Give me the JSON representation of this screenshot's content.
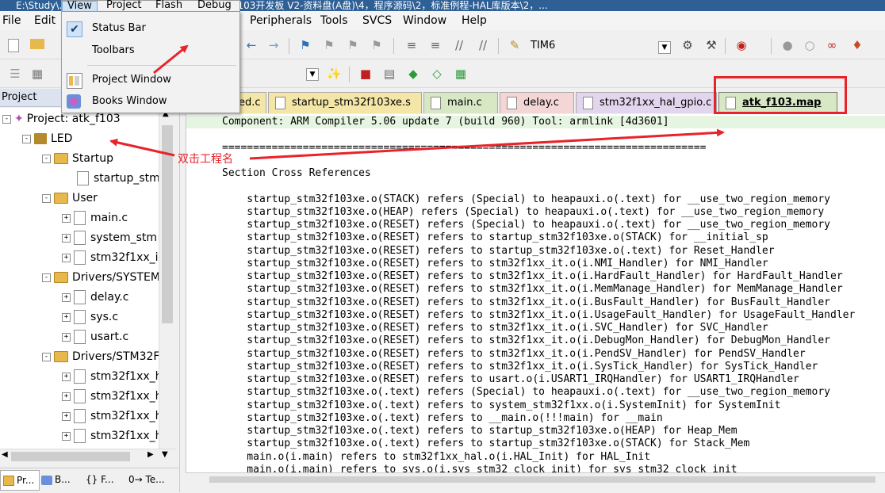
{
  "titlebar": {
    "text": "E:\\Study\\...\\Document\\【正点原子】精英STM32F103开发板 V2-资料盘(A盘)\\4，程序源码\\2，标准例程-HAL库版本\\2，..."
  },
  "menubar": {
    "items": [
      "File",
      "Edit",
      "View",
      "Project",
      "Flash",
      "Debug",
      "Peripherals",
      "Tools",
      "SVCS",
      "Window",
      "Help"
    ]
  },
  "toolbar": {
    "target_label": "TIM6"
  },
  "view_menu": {
    "items": [
      {
        "label": "Status Bar",
        "checked": true,
        "icon": "checkmark-icon"
      },
      {
        "label": "Toolbars",
        "checked": false,
        "icon": ""
      },
      {
        "label": "Project Window",
        "checked": false,
        "icon": "project-window-icon"
      },
      {
        "label": "Books Window",
        "checked": false,
        "icon": "books-window-icon"
      }
    ]
  },
  "project_panel": {
    "header": "Project",
    "tree": [
      {
        "label": "Project: atk_f103",
        "kind": "project",
        "level": 0,
        "expander": "-"
      },
      {
        "label": "LED",
        "kind": "target",
        "level": 1,
        "expander": "-"
      },
      {
        "label": "Startup",
        "kind": "folder",
        "level": 2,
        "expander": "-"
      },
      {
        "label": "startup_stm",
        "kind": "file",
        "level": 3,
        "expander": ""
      },
      {
        "label": "User",
        "kind": "folder",
        "level": 2,
        "expander": "-"
      },
      {
        "label": "main.c",
        "kind": "file",
        "level": 3,
        "expander": "+"
      },
      {
        "label": "system_stm",
        "kind": "file",
        "level": 3,
        "expander": "+"
      },
      {
        "label": "stm32f1xx_i",
        "kind": "file",
        "level": 3,
        "expander": "+"
      },
      {
        "label": "Drivers/SYSTEM",
        "kind": "folder",
        "level": 2,
        "expander": "-"
      },
      {
        "label": "delay.c",
        "kind": "file",
        "level": 3,
        "expander": "+"
      },
      {
        "label": "sys.c",
        "kind": "file",
        "level": 3,
        "expander": "+"
      },
      {
        "label": "usart.c",
        "kind": "file",
        "level": 3,
        "expander": "+"
      },
      {
        "label": "Drivers/STM32F",
        "kind": "folder",
        "level": 2,
        "expander": "-"
      },
      {
        "label": "stm32f1xx_h",
        "kind": "file",
        "level": 3,
        "expander": "+"
      },
      {
        "label": "stm32f1xx_h",
        "kind": "file",
        "level": 3,
        "expander": "+"
      },
      {
        "label": "stm32f1xx_h",
        "kind": "file",
        "level": 3,
        "expander": "+"
      },
      {
        "label": "stm32f1xx_h",
        "kind": "file",
        "level": 3,
        "expander": "+"
      }
    ],
    "bottom_tabs": [
      "Pr...",
      "B...",
      "{} F...",
      "0→ Te..."
    ]
  },
  "editor": {
    "tabs": [
      {
        "label": "ed.c",
        "color": "#f4e6a6",
        "active": false
      },
      {
        "label": "startup_stm32f103xe.s",
        "color": "#f4e6a6",
        "active": false
      },
      {
        "label": "main.c",
        "color": "#d8e7c4",
        "active": false
      },
      {
        "label": "delay.c",
        "color": "#f5d6d6",
        "active": false
      },
      {
        "label": "stm32f1xx_hal_gpio.c",
        "color": "#e2d6ee",
        "active": false
      },
      {
        "label": "atk_f103.map",
        "color": "#d8e7c4",
        "active": true
      }
    ],
    "lines": [
      "Component: ARM Compiler 5.06 update 7 (build 960) Tool: armlink [4d3601]",
      "",
      "==============================================================================",
      "",
      "Section Cross References",
      "",
      "    startup_stm32f103xe.o(STACK) refers (Special) to heapauxi.o(.text) for __use_two_region_memory",
      "    startup_stm32f103xe.o(HEAP) refers (Special) to heapauxi.o(.text) for __use_two_region_memory",
      "    startup_stm32f103xe.o(RESET) refers (Special) to heapauxi.o(.text) for __use_two_region_memory",
      "    startup_stm32f103xe.o(RESET) refers to startup_stm32f103xe.o(STACK) for __initial_sp",
      "    startup_stm32f103xe.o(RESET) refers to startup_stm32f103xe.o(.text) for Reset_Handler",
      "    startup_stm32f103xe.o(RESET) refers to stm32f1xx_it.o(i.NMI_Handler) for NMI_Handler",
      "    startup_stm32f103xe.o(RESET) refers to stm32f1xx_it.o(i.HardFault_Handler) for HardFault_Handler",
      "    startup_stm32f103xe.o(RESET) refers to stm32f1xx_it.o(i.MemManage_Handler) for MemManage_Handler",
      "    startup_stm32f103xe.o(RESET) refers to stm32f1xx_it.o(i.BusFault_Handler) for BusFault_Handler",
      "    startup_stm32f103xe.o(RESET) refers to stm32f1xx_it.o(i.UsageFault_Handler) for UsageFault_Handler",
      "    startup_stm32f103xe.o(RESET) refers to stm32f1xx_it.o(i.SVC_Handler) for SVC_Handler",
      "    startup_stm32f103xe.o(RESET) refers to stm32f1xx_it.o(i.DebugMon_Handler) for DebugMon_Handler",
      "    startup_stm32f103xe.o(RESET) refers to stm32f1xx_it.o(i.PendSV_Handler) for PendSV_Handler",
      "    startup_stm32f103xe.o(RESET) refers to stm32f1xx_it.o(i.SysTick_Handler) for SysTick_Handler",
      "    startup_stm32f103xe.o(RESET) refers to usart.o(i.USART1_IRQHandler) for USART1_IRQHandler",
      "    startup_stm32f103xe.o(.text) refers (Special) to heapauxi.o(.text) for __use_two_region_memory",
      "    startup_stm32f103xe.o(.text) refers to system_stm32f1xx.o(i.SystemInit) for SystemInit",
      "    startup_stm32f103xe.o(.text) refers to __main.o(!!!main) for __main",
      "    startup_stm32f103xe.o(.text) refers to startup_stm32f103xe.o(HEAP) for Heap_Mem",
      "    startup_stm32f103xe.o(.text) refers to startup_stm32f103xe.o(STACK) for Stack_Mem",
      "    main.o(i.main) refers to stm32f1xx_hal.o(i.HAL_Init) for HAL_Init",
      "    main.o(i.main) refers to sys.o(i.sys_stm32_clock_init) for sys_stm32_clock_init"
    ]
  },
  "annotation": {
    "text": "双击工程名",
    "color": "#e8232a"
  }
}
